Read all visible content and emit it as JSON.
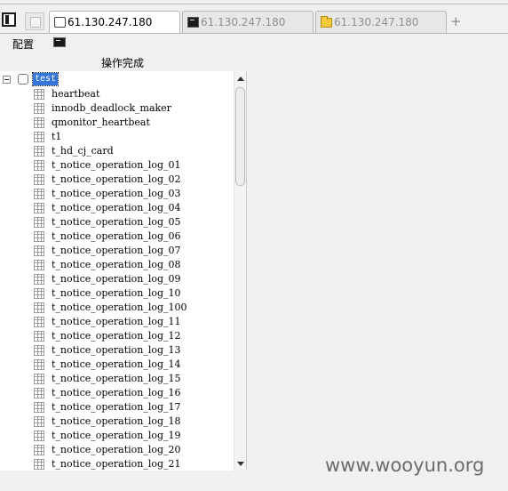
{
  "tabs": [
    {
      "label": "61.130.247.180",
      "icon": "blank-page-icon",
      "active": true
    },
    {
      "label": "61.130.247.180",
      "icon": "terminal-icon",
      "active": false
    },
    {
      "label": "61.130.247.180",
      "icon": "folder-icon",
      "active": false
    }
  ],
  "new_tab_label": "+",
  "menu": {
    "config_label": "配置"
  },
  "status": {
    "text": "操作完成"
  },
  "tree": {
    "root": {
      "label": "test",
      "expander": "⊟"
    },
    "items": [
      "heartbeat",
      "innodb_deadlock_maker",
      "qmonitor_heartbeat",
      "t1",
      "t_hd_cj_card",
      "t_notice_operation_log_01",
      "t_notice_operation_log_02",
      "t_notice_operation_log_03",
      "t_notice_operation_log_04",
      "t_notice_operation_log_05",
      "t_notice_operation_log_06",
      "t_notice_operation_log_07",
      "t_notice_operation_log_08",
      "t_notice_operation_log_09",
      "t_notice_operation_log_10",
      "t_notice_operation_log_100",
      "t_notice_operation_log_11",
      "t_notice_operation_log_12",
      "t_notice_operation_log_13",
      "t_notice_operation_log_14",
      "t_notice_operation_log_15",
      "t_notice_operation_log_16",
      "t_notice_operation_log_17",
      "t_notice_operation_log_18",
      "t_notice_operation_log_19",
      "t_notice_operation_log_20",
      "t_notice_operation_log_21"
    ]
  },
  "watermark": "www.wooyun.org",
  "colors": {
    "selection": "#3574d8",
    "background": "#f0f0f0"
  }
}
